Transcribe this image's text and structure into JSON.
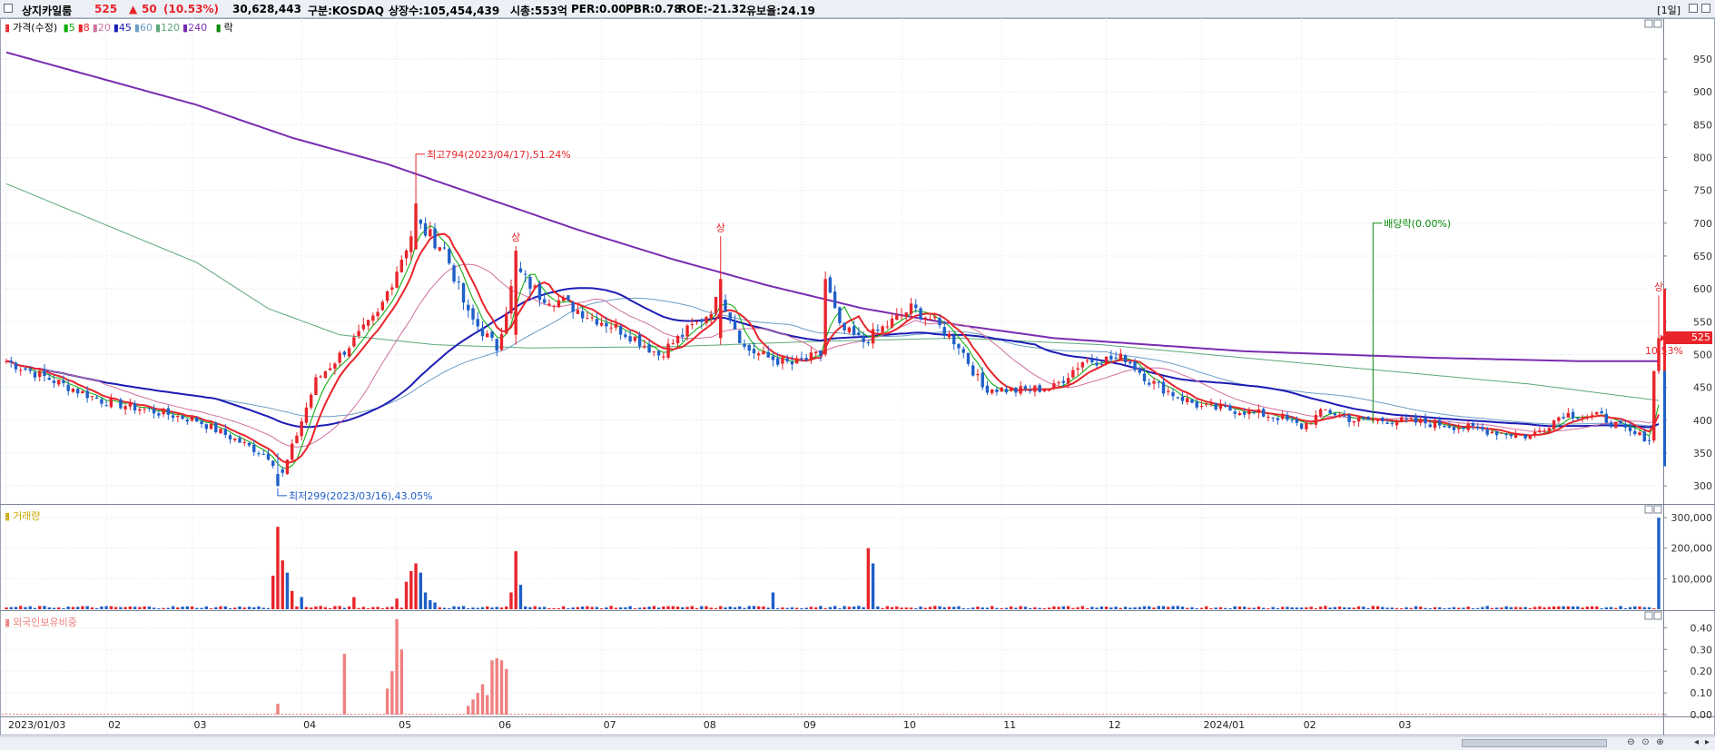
{
  "header": {
    "name": "상지카일룸",
    "price": "525",
    "arrow": "▲",
    "change": "50",
    "change_pct": "(10.53%)",
    "volume": "30,628,443",
    "market": "구분:KOSDAQ",
    "shares": "상장수:105,454,439",
    "mcap": "시총:553억",
    "per": "PER:0.00",
    "pbr": "PBR:0.78",
    "roe": "ROE:-21.32",
    "float": "유보율:24.19",
    "period": "[1일]"
  },
  "legend": {
    "price": "가격(수정)",
    "ma": [
      {
        "label": "5",
        "color": "#00aa00"
      },
      {
        "label": "8",
        "color": "#e8252b"
      },
      {
        "label": "20",
        "color": "#d070a0"
      },
      {
        "label": "45",
        "color": "#1c1cb4"
      },
      {
        "label": "60",
        "color": "#6d9dc5"
      },
      {
        "label": "120",
        "color": "#5aa87a"
      },
      {
        "label": "240",
        "color": "#7a2cb0"
      }
    ],
    "drop": "락",
    "volume": "거래량",
    "foreign": "외국인보유비중"
  },
  "colors": {
    "up": "#e8252b",
    "down": "#1f5fc8"
  },
  "price_tag": {
    "value": "525",
    "pct": "10.53%"
  },
  "chart_data": [
    {
      "type": "candlestick",
      "title": "가격(수정)",
      "y_ticks": [
        300,
        350,
        400,
        450,
        500,
        550,
        600,
        650,
        700,
        750,
        800,
        850,
        900,
        950
      ],
      "ylim": [
        285,
        990
      ],
      "x_tick_labels": [
        "2023/01/03",
        "02",
        "03",
        "04",
        "05",
        "06",
        "07",
        "08",
        "09",
        "10",
        "11",
        "12",
        "2024/01",
        "02",
        "03"
      ],
      "anchors": [
        [
          0,
          490
        ],
        [
          20,
          430
        ],
        [
          40,
          400
        ],
        [
          55,
          345
        ],
        [
          58,
          318
        ],
        [
          65,
          460
        ],
        [
          78,
          560
        ],
        [
          86,
          700
        ],
        [
          92,
          660
        ],
        [
          97,
          560
        ],
        [
          103,
          510
        ],
        [
          107,
          630
        ],
        [
          112,
          590
        ],
        [
          117,
          580
        ],
        [
          122,
          560
        ],
        [
          127,
          545
        ],
        [
          132,
          525
        ],
        [
          137,
          500
        ],
        [
          142,
          530
        ],
        [
          147,
          560
        ],
        [
          150,
          590
        ],
        [
          155,
          510
        ],
        [
          160,
          495
        ],
        [
          165,
          485
        ],
        [
          171,
          500
        ],
        [
          172,
          615
        ],
        [
          175,
          540
        ],
        [
          180,
          520
        ],
        [
          185,
          545
        ],
        [
          190,
          570
        ],
        [
          194,
          555
        ],
        [
          200,
          515
        ],
        [
          205,
          450
        ],
        [
          212,
          445
        ],
        [
          220,
          450
        ],
        [
          226,
          490
        ],
        [
          235,
          495
        ],
        [
          240,
          460
        ],
        [
          245,
          440
        ],
        [
          251,
          420
        ],
        [
          259,
          415
        ],
        [
          267,
          405
        ],
        [
          272,
          390
        ],
        [
          277,
          415
        ],
        [
          283,
          400
        ],
        [
          290,
          400
        ],
        [
          300,
          395
        ],
        [
          310,
          385
        ],
        [
          320,
          375
        ],
        [
          327,
          410
        ],
        [
          335,
          405
        ],
        [
          341,
          380
        ],
        [
          346,
          370
        ],
        [
          347,
          525
        ]
      ],
      "special_bars": [
        [
          57,
          318,
          300,
          299,
          350
        ],
        [
          86,
          660,
          730,
          660,
          794
        ],
        [
          107,
          530,
          658,
          515,
          665
        ],
        [
          150,
          525,
          615,
          515,
          680
        ],
        [
          347,
          475,
          525,
          470,
          590
        ]
      ],
      "annotations": [
        {
          "text": "최고794(2023/04/17),51.24%",
          "x": 86,
          "y": 794
        },
        {
          "text": "최저299(2023/03/16),43.05%",
          "x": 57,
          "y": 299
        },
        {
          "text": "배당락(0.00%)",
          "x": 287,
          "y": 700
        }
      ],
      "limit_up_marks": [
        {
          "text": "상",
          "x": 107
        },
        {
          "text": "상",
          "x": 150
        },
        {
          "text": "상",
          "x": 347
        }
      ],
      "ma_periods": [
        5,
        8,
        20,
        45,
        60,
        120,
        240
      ],
      "ma240_anchors": [
        [
          0,
          960
        ],
        [
          40,
          880
        ],
        [
          60,
          830
        ],
        [
          80,
          790
        ],
        [
          100,
          740
        ],
        [
          120,
          690
        ],
        [
          140,
          645
        ],
        [
          160,
          605
        ],
        [
          180,
          570
        ],
        [
          200,
          545
        ],
        [
          220,
          525
        ],
        [
          260,
          505
        ],
        [
          300,
          495
        ],
        [
          330,
          490
        ],
        [
          347,
          490
        ]
      ],
      "ma120_anchors": [
        [
          0,
          760
        ],
        [
          20,
          700
        ],
        [
          40,
          640
        ],
        [
          55,
          570
        ],
        [
          70,
          530
        ],
        [
          90,
          515
        ],
        [
          110,
          510
        ],
        [
          140,
          512
        ],
        [
          170,
          520
        ],
        [
          200,
          525
        ],
        [
          230,
          515
        ],
        [
          260,
          495
        ],
        [
          290,
          475
        ],
        [
          320,
          455
        ],
        [
          347,
          430
        ]
      ]
    },
    {
      "type": "bar",
      "title": "거래량",
      "y_ticks": [
        100000,
        200000,
        300000
      ],
      "ylim": [
        0,
        330000
      ],
      "spikes": [
        [
          56,
          110000,
          "up"
        ],
        [
          57,
          270000,
          "up"
        ],
        [
          58,
          160000,
          "up"
        ],
        [
          59,
          120000,
          "down"
        ],
        [
          60,
          60000,
          "up"
        ],
        [
          62,
          40000,
          "down"
        ],
        [
          73,
          40000,
          "up"
        ],
        [
          82,
          35000,
          "up"
        ],
        [
          84,
          90000,
          "up"
        ],
        [
          85,
          125000,
          "up"
        ],
        [
          86,
          150000,
          "up"
        ],
        [
          87,
          120000,
          "down"
        ],
        [
          88,
          55000,
          "down"
        ],
        [
          89,
          30000,
          "down"
        ],
        [
          90,
          22000,
          "down"
        ],
        [
          106,
          55000,
          "up"
        ],
        [
          107,
          190000,
          "up"
        ],
        [
          108,
          80000,
          "down"
        ],
        [
          161,
          55000,
          "down"
        ],
        [
          181,
          200000,
          "up"
        ],
        [
          182,
          150000,
          "down"
        ],
        [
          347,
          300000,
          "down"
        ]
      ],
      "base_volume": 7000
    },
    {
      "type": "bar",
      "title": "외국인보유비중",
      "y_ticks": [
        0.0,
        0.1,
        0.2,
        0.3,
        0.4
      ],
      "ylim": [
        0,
        0.46
      ],
      "values": [
        [
          57,
          0.05
        ],
        [
          71,
          0.28
        ],
        [
          80,
          0.12
        ],
        [
          81,
          0.2
        ],
        [
          82,
          0.44
        ],
        [
          83,
          0.3
        ],
        [
          97,
          0.04
        ],
        [
          98,
          0.07
        ],
        [
          99,
          0.1
        ],
        [
          100,
          0.14
        ],
        [
          101,
          0.09
        ],
        [
          102,
          0.25
        ],
        [
          103,
          0.26
        ],
        [
          104,
          0.25
        ],
        [
          105,
          0.21
        ]
      ]
    }
  ]
}
